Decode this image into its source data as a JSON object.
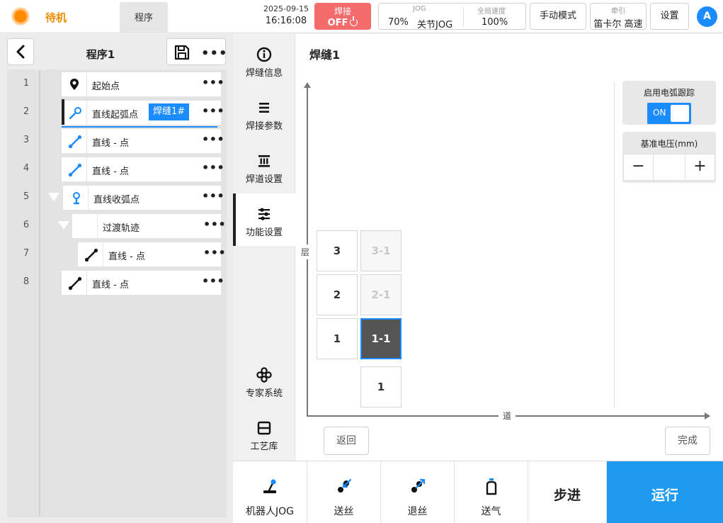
{
  "header": {
    "status": "待机",
    "program_tab": "程序",
    "date": "2025-09-15",
    "time": "16:16:08",
    "weld_label": "焊接",
    "weld_state": "OFF",
    "jog_label": "JOG",
    "jog_speed": "70%",
    "jog_mode": "关节JOG",
    "global_speed_label": "全局速度",
    "global_speed": "100%",
    "manual_mode": "手动模式",
    "traction_label": "牵引",
    "traction_value": "笛卡尔 高速",
    "settings": "设置",
    "avatar": "A"
  },
  "program": {
    "title": "程序1",
    "more": "•••",
    "rows": [
      {
        "num": "1",
        "label": "起始点",
        "icon": "location-pin-icon",
        "more": "•••"
      },
      {
        "num": "2",
        "label": "直线起弧点",
        "tag": "焊缝1#",
        "icon": "weld-torch-start-icon",
        "more": "•••"
      },
      {
        "num": "3",
        "label": "直线 - 点",
        "icon": "line-point-icon",
        "more": "•••"
      },
      {
        "num": "4",
        "label": "直线 - 点",
        "icon": "line-point-icon",
        "more": "•••"
      },
      {
        "num": "5",
        "label": "直线收弧点",
        "icon": "weld-torch-end-icon",
        "more": "•••"
      },
      {
        "num": "6",
        "label": "过渡轨迹",
        "more": "•••"
      },
      {
        "num": "7",
        "label": "直线 - 点",
        "icon": "line-point-icon",
        "more": "•••"
      },
      {
        "num": "8",
        "label": "直线 - 点",
        "icon": "line-point-icon",
        "more": "•••"
      }
    ]
  },
  "menu": {
    "items": [
      {
        "label": "焊缝信息",
        "icon": "info-icon"
      },
      {
        "label": "焊接参数",
        "icon": "list-icon"
      },
      {
        "label": "焊道设置",
        "icon": "weld-pass-icon"
      },
      {
        "label": "功能设置",
        "icon": "sliders-icon"
      },
      {
        "label": "专家系统",
        "icon": "expert-icon"
      },
      {
        "label": "工艺库",
        "icon": "library-icon"
      }
    ]
  },
  "main": {
    "title": "焊缝1",
    "y_axis_label": "层",
    "x_axis_label": "道",
    "layers": [
      {
        "label": "3",
        "pass": "3-1"
      },
      {
        "label": "2",
        "pass": "2-1"
      },
      {
        "label": "1",
        "pass": "1-1"
      }
    ],
    "pass_column": "1",
    "arc_tracking_label": "启用电弧跟踪",
    "arc_tracking_state": "ON",
    "base_voltage_label": "基准电压(mm)",
    "base_voltage_value": "",
    "minus": "−",
    "plus": "+",
    "back_button": "返回",
    "done_button": "完成"
  },
  "bottom": {
    "robot_jog": "机器人JOG",
    "feed_wire": "送丝",
    "retract_wire": "退丝",
    "gas": "送气",
    "step": "步进",
    "run": "运行"
  },
  "colors": {
    "accent": "#1a8cff",
    "weld_off": "#f36b6b",
    "status": "#f08c00",
    "run": "#1e9bf0"
  }
}
